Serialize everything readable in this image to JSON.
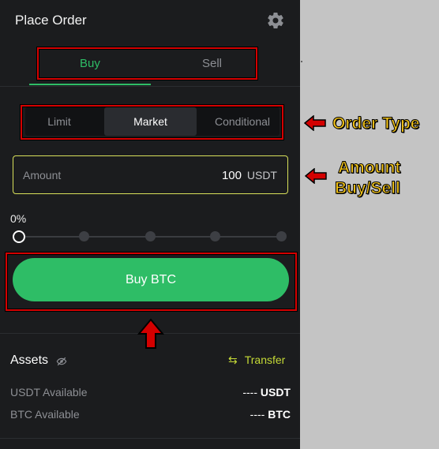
{
  "header": {
    "title": "Place Order"
  },
  "tabs": [
    {
      "label": "Buy",
      "active": true
    },
    {
      "label": "Sell",
      "active": false
    }
  ],
  "order_types": [
    {
      "label": "Limit"
    },
    {
      "label": "Market",
      "active": true
    },
    {
      "label": "Conditional"
    }
  ],
  "amount": {
    "placeholder": "Amount",
    "value": "100",
    "unit": "USDT"
  },
  "slider": {
    "percent_label": "0%",
    "value_fraction": 0.0,
    "stops": 5
  },
  "buy_button": {
    "label": "Buy BTC"
  },
  "assets": {
    "title": "Assets",
    "transfer_icon": "⇆",
    "transfer_label": "Transfer",
    "rows": [
      {
        "label": "USDT Available",
        "amount": "----",
        "currency": "USDT"
      },
      {
        "label": "BTC Available",
        "amount": "----",
        "currency": "BTC"
      }
    ]
  },
  "annotations": {
    "order_type": "Order Type",
    "amount_line1": "Amount",
    "amount_line2": "Buy/Sell"
  },
  "colors": {
    "accent_green": "#2ebd66",
    "highlight_yellow": "#d8e05a",
    "annotation_red": "#d40000",
    "annotation_text": "#f5c518"
  }
}
